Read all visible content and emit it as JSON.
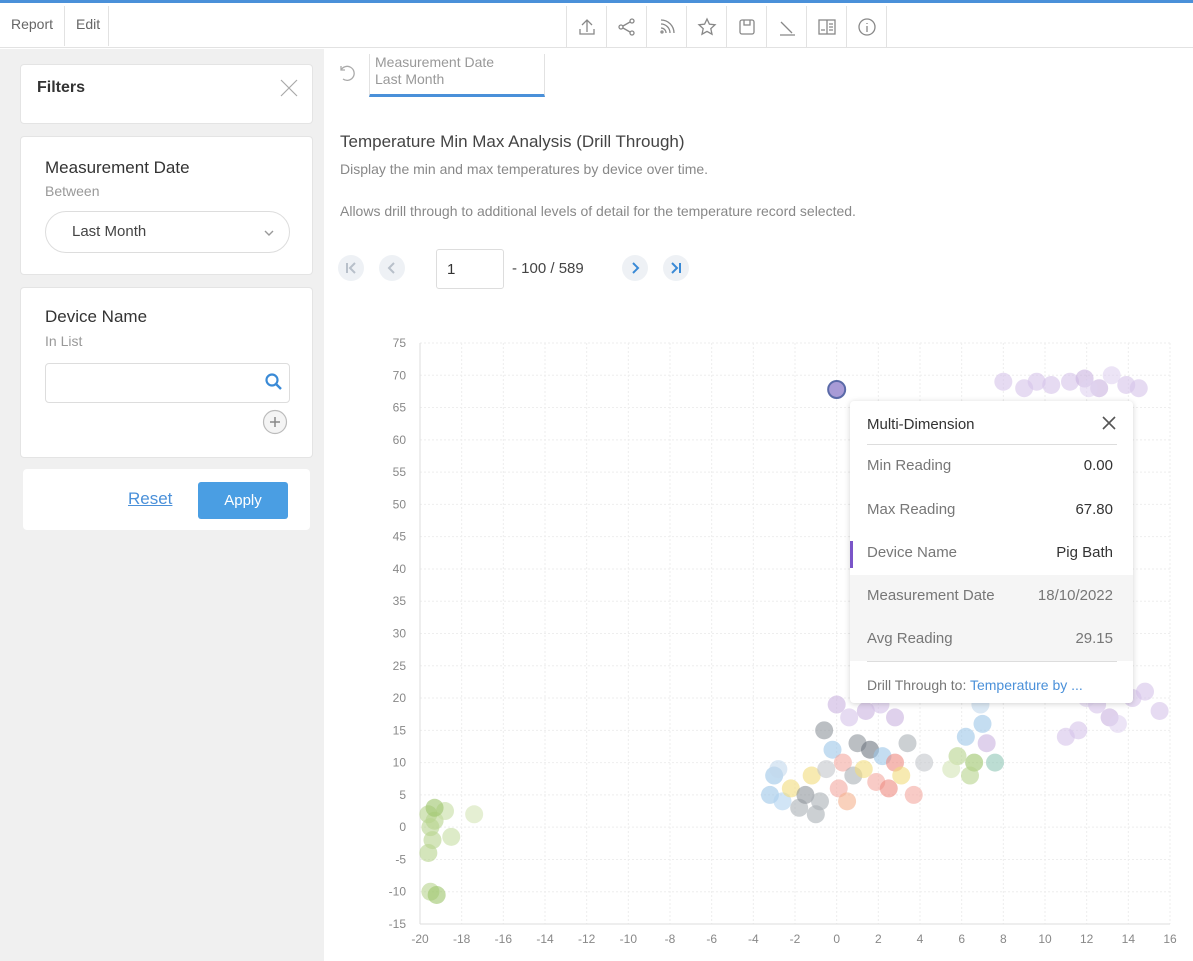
{
  "menu": {
    "report": "Report",
    "edit": "Edit"
  },
  "toolbar": [
    "export-icon",
    "share-icon",
    "rss-icon",
    "star-icon",
    "save-icon",
    "present-icon",
    "book-icon",
    "info-icon"
  ],
  "filters": {
    "title": "Filters",
    "measurement_date": {
      "title": "Measurement Date",
      "operator": "Between",
      "value": "Last Month"
    },
    "device_name": {
      "title": "Device Name",
      "operator": "In List",
      "value": ""
    },
    "reset_label": "Reset",
    "apply_label": "Apply"
  },
  "breadcrumb": {
    "line1": "Measurement Date",
    "line2": "Last Month"
  },
  "report": {
    "title": "Temperature Min Max Analysis (Drill Through)",
    "desc1": "Display the min and max temperatures by device over time.",
    "desc2": "Allows drill through to additional levels of detail for the temperature record selected."
  },
  "pager": {
    "page": "1",
    "range": "- 100 / 589"
  },
  "tooltip": {
    "title": "Multi-Dimension",
    "rows": [
      {
        "label": "Min Reading",
        "value": "0.00"
      },
      {
        "label": "Max Reading",
        "value": "67.80"
      },
      {
        "label": "Device Name",
        "value": "Pig Bath"
      },
      {
        "label": "Measurement Date",
        "value": "18/10/2022"
      },
      {
        "label": "Avg Reading",
        "value": "29.15"
      }
    ],
    "drill_prefix": "Drill Through to: ",
    "drill_link": "Temperature by ..."
  },
  "colors": {
    "accent": "#4a90d9",
    "apply": "#4a9ee3",
    "highlight": "#7a55c8"
  },
  "chart_data": {
    "type": "scatter",
    "title": "",
    "xlabel": "",
    "ylabel": "",
    "xlim": [
      -20,
      16
    ],
    "ylim": [
      -15,
      75
    ],
    "xticks": [
      -20,
      -18,
      -16,
      -14,
      -12,
      -10,
      -8,
      -6,
      -4,
      -2,
      0,
      2,
      4,
      6,
      8,
      10,
      12,
      14,
      16
    ],
    "yticks": [
      75,
      70,
      65,
      60,
      55,
      50,
      45,
      40,
      35,
      30,
      25,
      20,
      15,
      10,
      5,
      0,
      -5,
      -10,
      -15
    ],
    "grid": true,
    "selected": {
      "x": 0,
      "y": 67.8,
      "color": "#a89bd6"
    },
    "points": [
      {
        "x": -19.6,
        "y": 2,
        "c": "#b7d48d"
      },
      {
        "x": -19.5,
        "y": 0,
        "c": "#b7d48d"
      },
      {
        "x": -19.4,
        "y": -2,
        "c": "#b7d48d"
      },
      {
        "x": -19.6,
        "y": -4,
        "c": "#b7d48d"
      },
      {
        "x": -19.3,
        "y": 1,
        "c": "#b7d48d"
      },
      {
        "x": -19.5,
        "y": -10,
        "c": "#b7d48d"
      },
      {
        "x": -19.2,
        "y": -10.5,
        "c": "#9dc46a"
      },
      {
        "x": -18.8,
        "y": 2.5,
        "c": "#c7dea4"
      },
      {
        "x": -18.5,
        "y": -1.5,
        "c": "#c7dea4"
      },
      {
        "x": -17.4,
        "y": 2,
        "c": "#d3e5b6"
      },
      {
        "x": -19.3,
        "y": 3,
        "c": "#9dc46a"
      },
      {
        "x": -3.2,
        "y": 5,
        "c": "#9cc6e8"
      },
      {
        "x": -3.0,
        "y": 8,
        "c": "#9cc6e8"
      },
      {
        "x": -2.6,
        "y": 4,
        "c": "#b2d4f0"
      },
      {
        "x": -2.2,
        "y": 6,
        "c": "#f2dc7d"
      },
      {
        "x": -1.8,
        "y": 3,
        "c": "#aab0b6"
      },
      {
        "x": -1.5,
        "y": 5,
        "c": "#8d949b"
      },
      {
        "x": -1.2,
        "y": 8,
        "c": "#f2dc7d"
      },
      {
        "x": -0.8,
        "y": 4,
        "c": "#aab0b6"
      },
      {
        "x": -0.5,
        "y": 9,
        "c": "#c3c7cc"
      },
      {
        "x": -0.2,
        "y": 12,
        "c": "#9cc6e8"
      },
      {
        "x": 0.1,
        "y": 6,
        "c": "#f4a9a0"
      },
      {
        "x": 0.3,
        "y": 10,
        "c": "#f4a9a0"
      },
      {
        "x": 0.5,
        "y": 4,
        "c": "#f5b28f"
      },
      {
        "x": 0.8,
        "y": 8,
        "c": "#aab0b6"
      },
      {
        "x": 1.0,
        "y": 13,
        "c": "#8d949b"
      },
      {
        "x": 1.3,
        "y": 9,
        "c": "#f2dc7d"
      },
      {
        "x": 1.6,
        "y": 12,
        "c": "#6e7780"
      },
      {
        "x": 1.9,
        "y": 7,
        "c": "#f4a9a0"
      },
      {
        "x": 2.2,
        "y": 11,
        "c": "#9cc6e8"
      },
      {
        "x": 2.5,
        "y": 6,
        "c": "#ee8a80"
      },
      {
        "x": 2.8,
        "y": 10,
        "c": "#ee8a80"
      },
      {
        "x": 3.1,
        "y": 8,
        "c": "#f2dc7d"
      },
      {
        "x": 3.4,
        "y": 13,
        "c": "#aab0b6"
      },
      {
        "x": 3.7,
        "y": 5,
        "c": "#f4a9a0"
      },
      {
        "x": 0.0,
        "y": 19,
        "c": "#c9b3e0"
      },
      {
        "x": 0.6,
        "y": 17,
        "c": "#d6c3ea"
      },
      {
        "x": 1.4,
        "y": 18,
        "c": "#c9b3e0"
      },
      {
        "x": 2.1,
        "y": 19,
        "c": "#d6c3ea"
      },
      {
        "x": 2.8,
        "y": 17,
        "c": "#c9b3e0"
      },
      {
        "x": -0.6,
        "y": 15,
        "c": "#8d949b"
      },
      {
        "x": -2.8,
        "y": 9,
        "c": "#c3d9ec"
      },
      {
        "x": -1.0,
        "y": 2,
        "c": "#aab0b6"
      },
      {
        "x": 4.2,
        "y": 10,
        "c": "#c3c7cc"
      },
      {
        "x": 5.8,
        "y": 11,
        "c": "#b7d48d"
      },
      {
        "x": 6.2,
        "y": 14,
        "c": "#9cc6e8"
      },
      {
        "x": 6.6,
        "y": 10,
        "c": "#9dc46a"
      },
      {
        "x": 7.0,
        "y": 16,
        "c": "#9cc6e8"
      },
      {
        "x": 7.2,
        "y": 13,
        "c": "#c9b3e0"
      },
      {
        "x": 7.6,
        "y": 10,
        "c": "#8fc7b6"
      },
      {
        "x": 6.4,
        "y": 8,
        "c": "#b7d48d"
      },
      {
        "x": 5.5,
        "y": 9,
        "c": "#d3e5b6"
      },
      {
        "x": 6.9,
        "y": 19,
        "c": "#c3d9ec"
      },
      {
        "x": 11.0,
        "y": 14,
        "c": "#d6c3ea"
      },
      {
        "x": 11.6,
        "y": 15,
        "c": "#d6c3ea"
      },
      {
        "x": 12.5,
        "y": 19,
        "c": "#d6c3ea"
      },
      {
        "x": 13.1,
        "y": 17,
        "c": "#c9b3e0"
      },
      {
        "x": 14.2,
        "y": 20,
        "c": "#d6c3ea"
      },
      {
        "x": 14.8,
        "y": 21,
        "c": "#d6c3ea"
      },
      {
        "x": 15.5,
        "y": 18,
        "c": "#d6c3ea"
      },
      {
        "x": 12.0,
        "y": 20,
        "c": "#e0d2f0"
      },
      {
        "x": 13.5,
        "y": 16,
        "c": "#e0d2f0"
      },
      {
        "x": 8.0,
        "y": 69,
        "c": "#d6c3ea"
      },
      {
        "x": 9.0,
        "y": 68,
        "c": "#d6c3ea"
      },
      {
        "x": 9.6,
        "y": 69,
        "c": "#d6c3ea"
      },
      {
        "x": 10.3,
        "y": 68.5,
        "c": "#d6c3ea"
      },
      {
        "x": 11.2,
        "y": 69,
        "c": "#d6c3ea"
      },
      {
        "x": 11.9,
        "y": 69.5,
        "c": "#c9b3e0"
      },
      {
        "x": 12.6,
        "y": 68,
        "c": "#c9b3e0"
      },
      {
        "x": 13.2,
        "y": 70,
        "c": "#e0d2f0"
      },
      {
        "x": 13.9,
        "y": 68.5,
        "c": "#d6c3ea"
      },
      {
        "x": 14.5,
        "y": 68,
        "c": "#d6c3ea"
      },
      {
        "x": 12.1,
        "y": 68,
        "c": "#e0d2f0"
      }
    ]
  }
}
